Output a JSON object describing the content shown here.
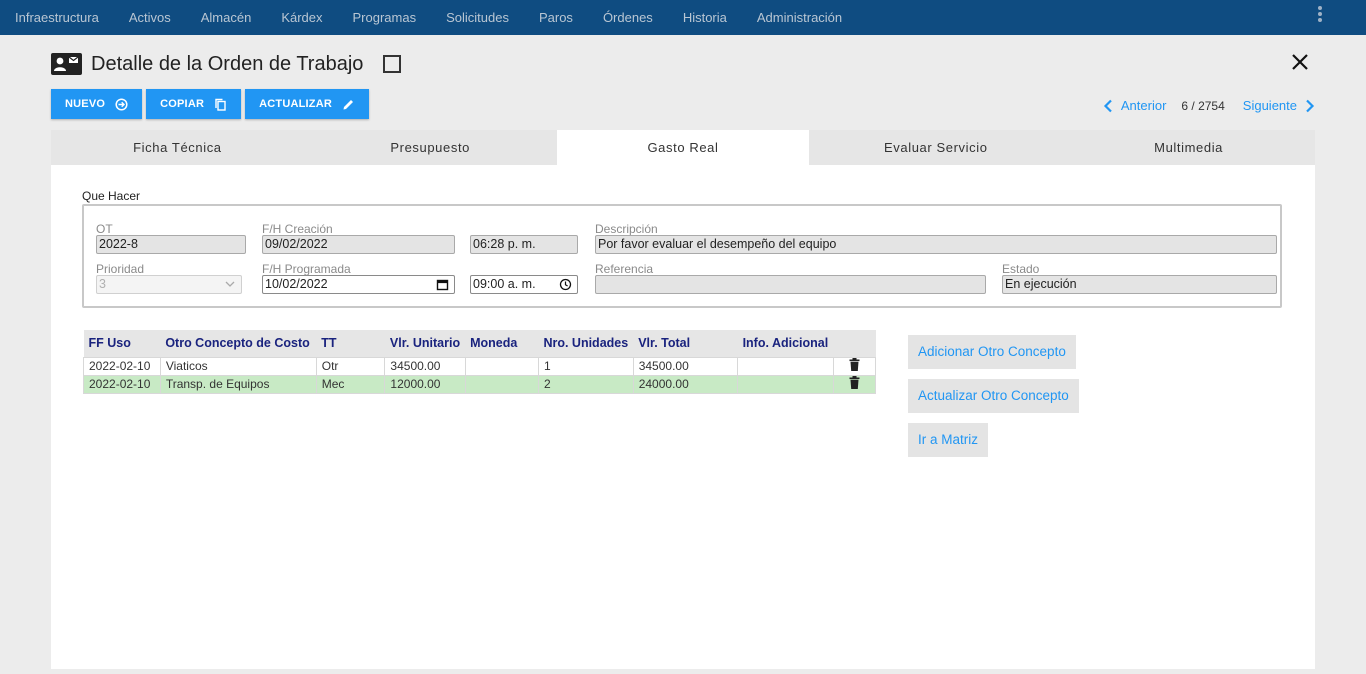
{
  "nav": {
    "items": [
      "Infraestructura",
      "Activos",
      "Almacén",
      "Kárdex",
      "Programas",
      "Solicitudes",
      "Paros",
      "Órdenes",
      "Historia",
      "Administración"
    ]
  },
  "header": {
    "title": "Detalle de la Orden de Trabajo",
    "icon": "contact-card-icon"
  },
  "toolbar": {
    "nuevo_label": "NUEVO",
    "copiar_label": "COPIAR",
    "actualizar_label": "ACTUALIZAR"
  },
  "pager": {
    "prev_label": "Anterior",
    "count": "6 / 2754",
    "next_label": "Siguiente"
  },
  "tabs": [
    {
      "label": "Ficha Técnica"
    },
    {
      "label": "Presupuesto"
    },
    {
      "label": "Gasto Real"
    },
    {
      "label": "Evaluar Servicio"
    },
    {
      "label": "Multimedia"
    }
  ],
  "active_tab": "Gasto Real",
  "form": {
    "legend": "Que Hacer",
    "ot_label": "OT",
    "ot_value": "2022-8",
    "fh_creacion_label": "F/H Creación",
    "fh_creacion_date": "09/02/2022",
    "fh_creacion_time": "06:28 p. m.",
    "descripcion_label": "Descripción",
    "descripcion_value": "Por favor evaluar el desempeño del equipo",
    "prioridad_label": "Prioridad",
    "prioridad_value": "3",
    "fh_programada_label": "F/H Programada",
    "fh_programada_date": "10/02/2022",
    "fh_programada_time": "09:00 a. m.",
    "referencia_label": "Referencia",
    "referencia_value": "",
    "estado_label": "Estado",
    "estado_value": "En ejecución"
  },
  "table": {
    "headers": [
      "FF Uso",
      "Otro Concepto de Costo",
      "TT",
      "Vlr. Unitario",
      "Moneda",
      "Nro. Unidades",
      "Vlr. Total",
      "Info. Adicional"
    ],
    "rows": [
      {
        "ff_uso": "2022-02-10",
        "concepto": "Viaticos",
        "tt": "Otr",
        "vlr_unitario": "34500.00",
        "moneda": "",
        "nro_unidades": "1",
        "vlr_total": "34500.00",
        "info": ""
      },
      {
        "ff_uso": "2022-02-10",
        "concepto": "Transp. de Equipos",
        "tt": "Mec",
        "vlr_unitario": "12000.00",
        "moneda": "",
        "nro_unidades": "2",
        "vlr_total": "24000.00",
        "info": ""
      }
    ]
  },
  "actions": {
    "adicionar_label": "Adicionar Otro Concepto",
    "actualizar_label": "Actualizar Otro Concepto",
    "matriz_label": "Ir a Matriz"
  },
  "colors": {
    "topbar": "#0f4c81",
    "accent": "#2196f3",
    "selected_row": "#c8eac5",
    "header_text": "#1a237e"
  }
}
